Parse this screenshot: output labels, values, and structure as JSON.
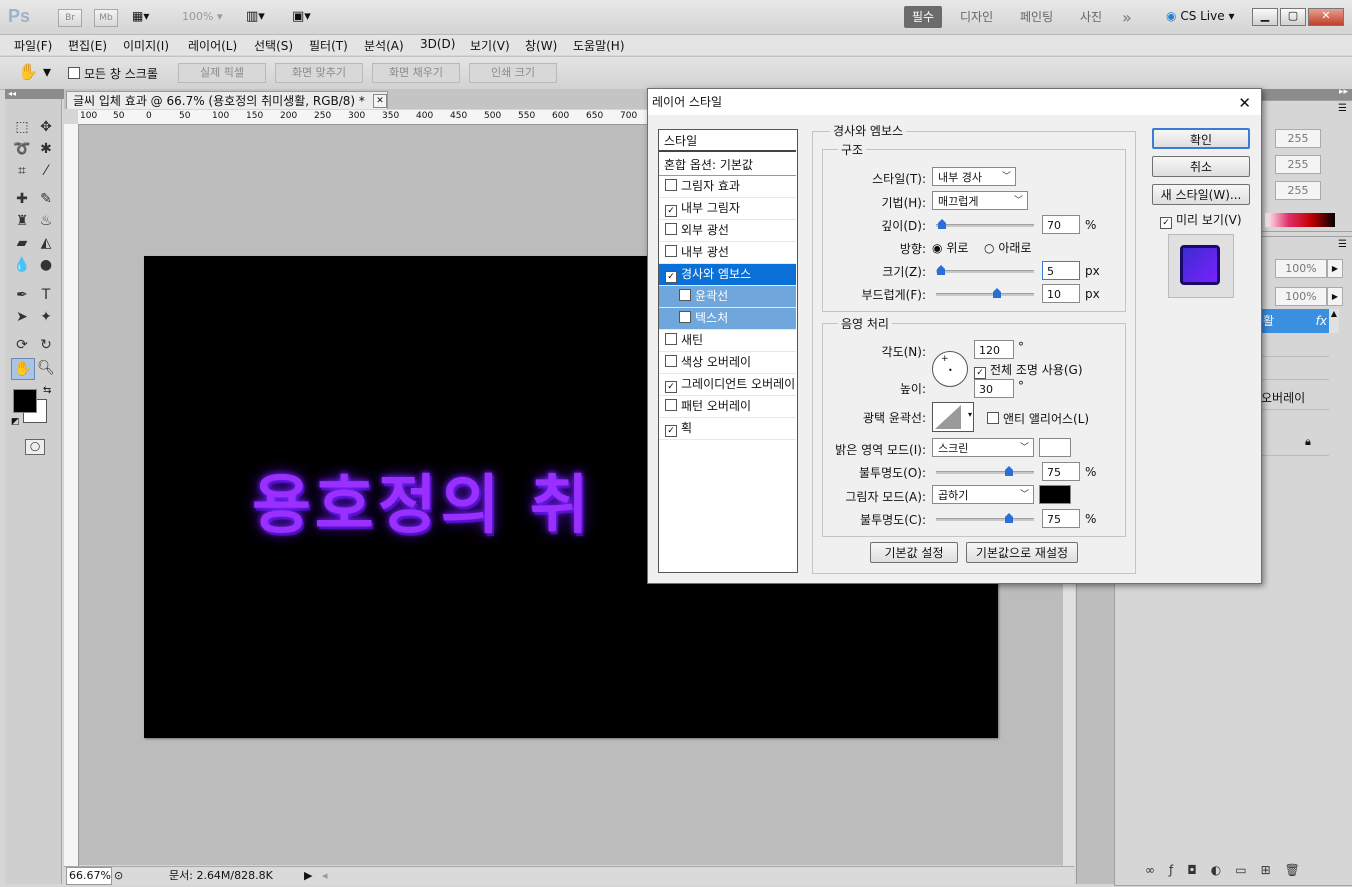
{
  "app": {
    "logo": "Ps",
    "br_label": "Br",
    "mb_label": "Mb",
    "zoom": "100%",
    "workspaces": [
      "필수",
      "디자인",
      "페인팅",
      "사진"
    ],
    "overflow": "»",
    "cslive": "CS Live"
  },
  "menu": [
    "파일(F)",
    "편집(E)",
    "이미지(I)",
    "레이어(L)",
    "선택(S)",
    "필터(T)",
    "분석(A)",
    "3D(D)",
    "보기(V)",
    "창(W)",
    "도움말(H)"
  ],
  "options": {
    "scroll_all": "모든 창 스크롤",
    "buttons": [
      "실제 픽셀",
      "화면 맞추기",
      "화면 채우기",
      "인쇄 크기"
    ]
  },
  "document": {
    "tab_title": "글씨 입체 효과 @ 66.7% (용호정의 취미생활, RGB/8) *",
    "ruler_ticks": [
      "100",
      "50",
      "0",
      "50",
      "100",
      "150",
      "200",
      "250",
      "300",
      "350",
      "400",
      "450",
      "500",
      "550",
      "600",
      "650",
      "700"
    ],
    "canvas_text": "용호정의 취",
    "zoom_status": "66.67%",
    "doc_size": "문서: 2.64M/828.8K"
  },
  "right_panels": {
    "rgb_values": [
      "255",
      "255",
      "255"
    ],
    "opacity": "100%",
    "fill": "100%",
    "layer_name": "활",
    "layer_fx": "fx",
    "effect_name": "오버레이"
  },
  "dialog": {
    "title": "레이어 스타일",
    "styles_header": "스타일",
    "blend_options": "혼합 옵션: 기본값",
    "styles": [
      {
        "label": "그림자 효과",
        "checked": false
      },
      {
        "label": "내부 그림자",
        "checked": true
      },
      {
        "label": "외부 광선",
        "checked": false
      },
      {
        "label": "내부 광선",
        "checked": false
      },
      {
        "label": "경사와 엠보스",
        "checked": true,
        "selected": true
      },
      {
        "label": "윤곽선",
        "checked": false,
        "sub": true
      },
      {
        "label": "텍스처",
        "checked": false,
        "sub": true
      },
      {
        "label": "새틴",
        "checked": false
      },
      {
        "label": "색상 오버레이",
        "checked": false
      },
      {
        "label": "그레이디언트 오버레이",
        "checked": true
      },
      {
        "label": "패턴 오버레이",
        "checked": false
      },
      {
        "label": "획",
        "checked": true
      }
    ],
    "section_title": "경사와 엠보스",
    "structure": {
      "title": "구조",
      "style_label": "스타일(T):",
      "style_value": "내부 경사",
      "technique_label": "기법(H):",
      "technique_value": "매끄럽게",
      "depth_label": "깊이(D):",
      "depth_value": "70",
      "depth_unit": "%",
      "direction_label": "방향:",
      "direction_up": "위로",
      "direction_down": "아래로",
      "size_label": "크기(Z):",
      "size_value": "5",
      "size_unit": "px",
      "soften_label": "부드럽게(F):",
      "soften_value": "10",
      "soften_unit": "px"
    },
    "shading": {
      "title": "음영 처리",
      "angle_label": "각도(N):",
      "angle_value": "120",
      "degree": "°",
      "global_light": "전체 조명 사용(G)",
      "altitude_label": "높이:",
      "altitude_value": "30",
      "gloss_label": "광택 윤곽선:",
      "anti_alias": "앤티 앨리어스(L)",
      "highlight_label": "밝은 영역 모드(I):",
      "highlight_value": "스크린",
      "highlight_opacity_label": "불투명도(O):",
      "highlight_opacity": "75",
      "pct": "%",
      "shadow_label": "그림자 모드(A):",
      "shadow_value": "곱하기",
      "shadow_opacity_label": "불투명도(C):",
      "shadow_opacity": "75"
    },
    "buttons": {
      "ok": "확인",
      "cancel": "취소",
      "new_style": "새 스타일(W)...",
      "preview": "미리 보기(V)",
      "default_set": "기본값 설정",
      "reset_default": "기본값으로 재설정"
    },
    "colors": {
      "highlight": "#ffffff",
      "shadow": "#000000",
      "accent": "#0a6fd6"
    }
  }
}
